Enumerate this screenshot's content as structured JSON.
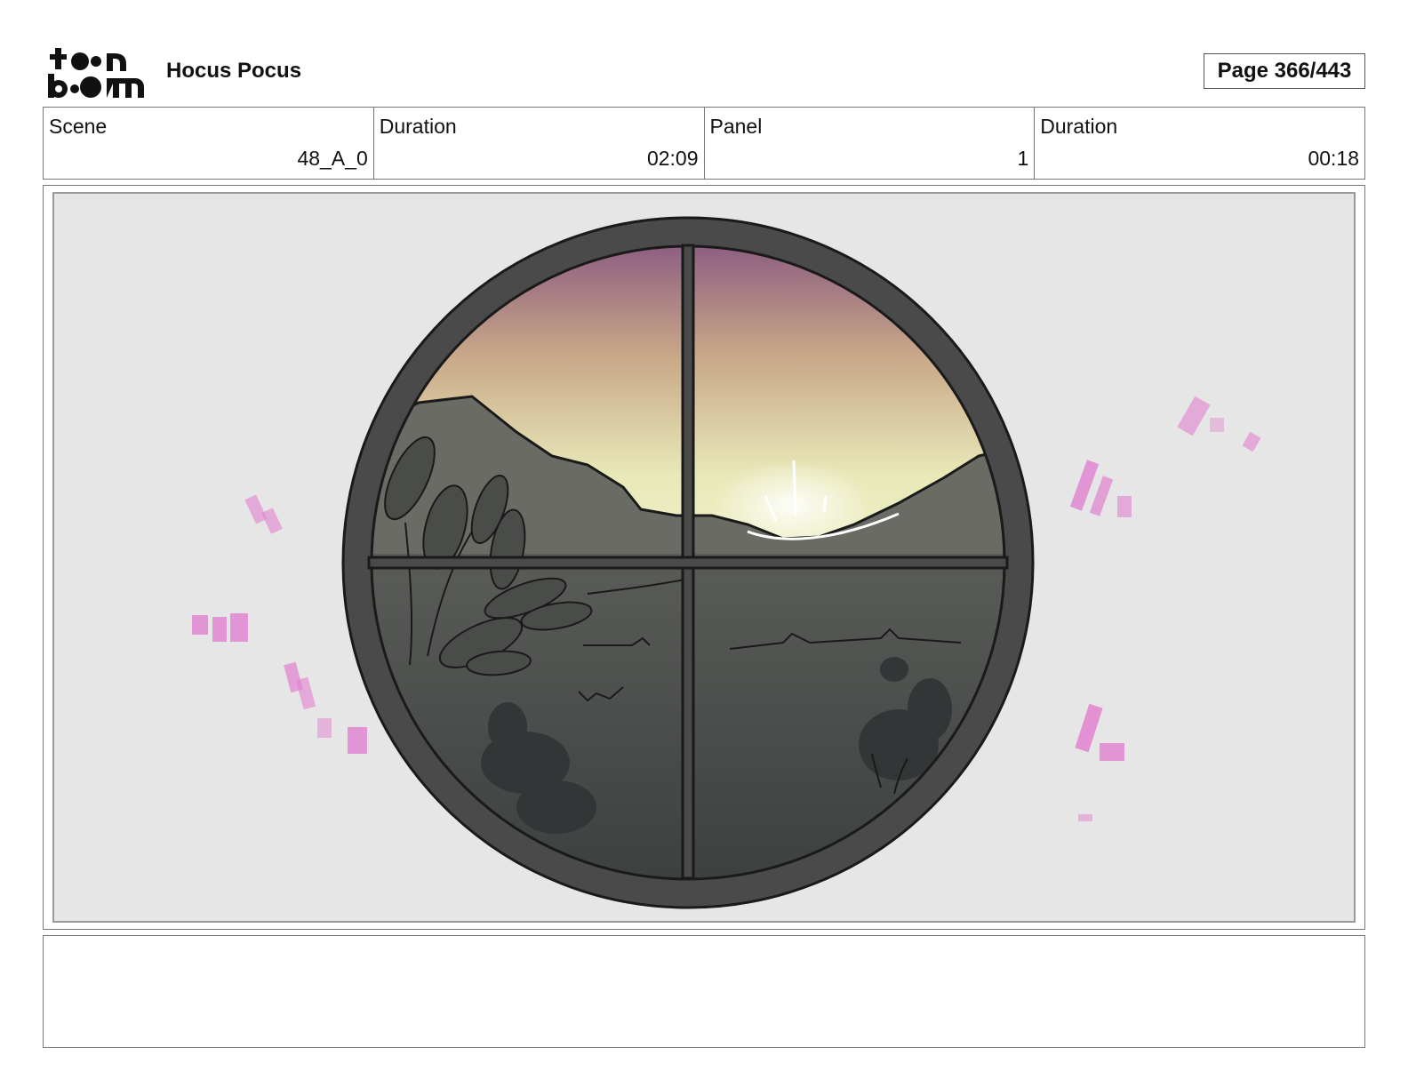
{
  "header": {
    "logo": {
      "text_line1": "toon",
      "text_line2": "boom",
      "icon": "toon-boom-logo"
    },
    "title": "Hocus Pocus",
    "page_label": "Page 366/443"
  },
  "info": {
    "scene_label": "Scene",
    "scene_value": "48_A_0",
    "scene_duration_label": "Duration",
    "scene_duration_value": "02:09",
    "panel_label": "Panel",
    "panel_value": "1",
    "panel_duration_label": "Duration",
    "panel_duration_value": "00:18"
  },
  "panel": {
    "image_subject": "round-window-landscape-sketch",
    "colors": {
      "background": "#e6e6e6",
      "frame": "#4a4a4a",
      "sky_top": "#8a5a80",
      "sky_mid": "#d2b48c",
      "sky_low": "#eef0c0",
      "hills": "#6b6b65",
      "ground": "#3e4241",
      "sparkle": "#e060c8"
    }
  },
  "notes": {
    "text": ""
  }
}
